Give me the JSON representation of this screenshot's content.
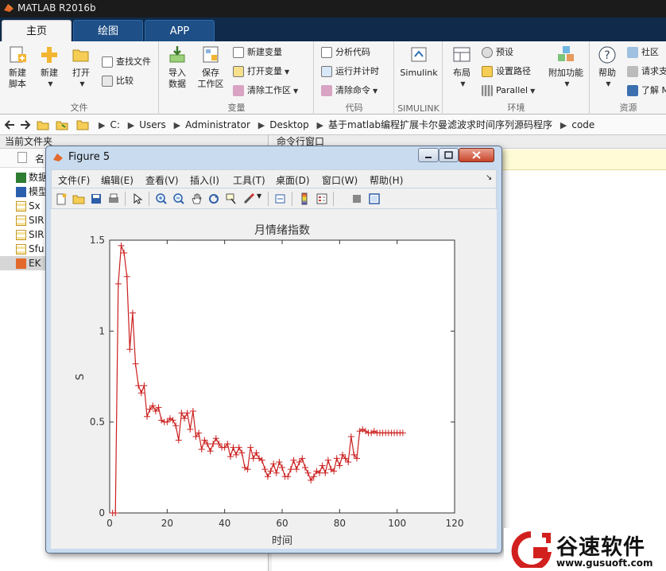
{
  "app": {
    "title": "MATLAB R2016b"
  },
  "tabs": [
    {
      "label": "主页"
    },
    {
      "label": "绘图"
    },
    {
      "label": "APP"
    }
  ],
  "ribbon": {
    "file_group": {
      "label": "文件",
      "new_script": "新建\n脚本",
      "new": "新建",
      "open": "打开",
      "find_files": "查找文件",
      "compare": "比较"
    },
    "variable_group": {
      "label": "变量",
      "import": "导入\n数据",
      "save_ws": "保存\n工作区",
      "new_var": "新建变量",
      "open_var": "打开变量",
      "clear_ws": "清除工作区"
    },
    "code_group": {
      "label": "代码",
      "analyze": "分析代码",
      "run_time": "运行并计时",
      "clear_cmd": "清除命令"
    },
    "simulink_group": {
      "label": "SIMULINK",
      "simulink": "Simulink"
    },
    "env_group": {
      "label": "环境",
      "layout": "布局",
      "prefs": "预设",
      "set_path": "设置路径",
      "parallel": "Parallel",
      "addons": "附加功能"
    },
    "resources_group": {
      "label": "资源",
      "help": "帮助",
      "community": "社区",
      "request": "请求支",
      "learn": "了解 M"
    }
  },
  "address": {
    "segments": [
      "C:",
      "Users",
      "Administrator",
      "Desktop",
      "基于matlab编程扩展卡尔曼滤波求时间序列源码程序",
      "code"
    ]
  },
  "current_folder": {
    "title": "当前文件夹",
    "name_header": "名",
    "files": [
      {
        "name": "数据",
        "icon": "excel-file-icon"
      },
      {
        "name": "模型",
        "icon": "word-file-icon"
      },
      {
        "name": "Sx",
        "icon": "mat-file-icon"
      },
      {
        "name": "SIR",
        "icon": "mat-file-icon"
      },
      {
        "name": "SIR",
        "icon": "mat-file-icon"
      },
      {
        "name": "Sfu",
        "icon": "mat-file-icon"
      },
      {
        "name": "EK",
        "icon": "m-file-icon"
      }
    ]
  },
  "command_window": {
    "title": "命令行窗口"
  },
  "figure": {
    "title": "Figure 5",
    "menu": [
      "文件(F)",
      "编辑(E)",
      "查看(V)",
      "插入(I)",
      "工具(T)",
      "桌面(D)",
      "窗口(W)",
      "帮助(H)"
    ]
  },
  "chart_data": {
    "type": "line",
    "title": "月情绪指数",
    "xlabel": "时间",
    "ylabel": "S",
    "xlim": [
      0,
      120
    ],
    "ylim": [
      0,
      1.5
    ],
    "xticks": [
      "0",
      "20",
      "40",
      "60",
      "80",
      "100",
      "120"
    ],
    "yticks": [
      "0",
      "0.5",
      "1",
      "1.5"
    ],
    "grid": false,
    "marker": "+",
    "line_color": "#cc1f1f",
    "x": [
      1,
      2,
      3,
      4,
      5,
      6,
      7,
      8,
      9,
      10,
      11,
      12,
      13,
      14,
      15,
      16,
      17,
      18,
      19,
      20,
      21,
      22,
      23,
      24,
      25,
      26,
      27,
      28,
      29,
      30,
      31,
      32,
      33,
      34,
      35,
      36,
      37,
      38,
      39,
      40,
      41,
      42,
      43,
      44,
      45,
      46,
      47,
      48,
      49,
      50,
      51,
      52,
      53,
      54,
      55,
      56,
      57,
      58,
      59,
      60,
      61,
      62,
      63,
      64,
      65,
      66,
      67,
      68,
      69,
      70,
      71,
      72,
      73,
      74,
      75,
      76,
      77,
      78,
      79,
      80,
      81,
      82,
      83,
      84,
      85,
      86,
      87,
      88,
      89,
      90,
      91,
      92,
      93,
      94,
      95,
      96,
      97,
      98,
      99,
      100,
      101,
      102
    ],
    "y": [
      0,
      0,
      1.26,
      1.47,
      1.43,
      1.3,
      0.9,
      1.1,
      0.82,
      0.7,
      0.66,
      0.7,
      0.53,
      0.57,
      0.59,
      0.56,
      0.58,
      0.51,
      0.5,
      0.5,
      0.52,
      0.51,
      0.48,
      0.4,
      0.55,
      0.52,
      0.55,
      0.46,
      0.56,
      0.42,
      0.44,
      0.35,
      0.4,
      0.38,
      0.34,
      0.38,
      0.41,
      0.38,
      0.36,
      0.36,
      0.38,
      0.31,
      0.36,
      0.32,
      0.36,
      0.33,
      0.25,
      0.24,
      0.36,
      0.3,
      0.33,
      0.3,
      0.29,
      0.24,
      0.2,
      0.23,
      0.27,
      0.22,
      0.28,
      0.25,
      0.2,
      0.2,
      0.24,
      0.29,
      0.24,
      0.28,
      0.3,
      0.25,
      0.22,
      0.18,
      0.2,
      0.23,
      0.22,
      0.26,
      0.22,
      0.29,
      0.24,
      0.23,
      0.3,
      0.26,
      0.32,
      0.3,
      0.28,
      0.42,
      0.32,
      0.3,
      0.45,
      0.46,
      0.45,
      0.44,
      0.44,
      0.45,
      0.44,
      0.44,
      0.44,
      0.44,
      0.44,
      0.44,
      0.44,
      0.44,
      0.44,
      0.44
    ]
  },
  "watermark": {
    "brand": "谷速软件",
    "url": "www.gusuoft.com"
  }
}
